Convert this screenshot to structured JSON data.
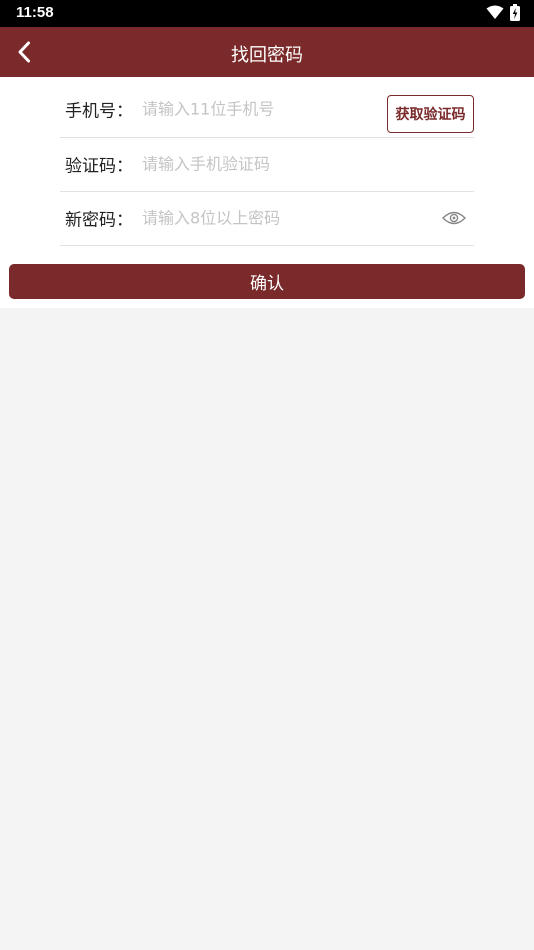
{
  "status_bar": {
    "time": "11:58"
  },
  "app_bar": {
    "title": "找回密码"
  },
  "form": {
    "phone": {
      "label": "手机号：",
      "placeholder": "请输入11位手机号",
      "value": ""
    },
    "get_code_label": "获取验证码",
    "code": {
      "label": "验证码：",
      "placeholder": "请输入手机验证码",
      "value": ""
    },
    "password": {
      "label": "新密码：",
      "placeholder": "请输入8位以上密码",
      "value": ""
    },
    "confirm_label": "确认"
  },
  "colors": {
    "brand": "#7a2a2a",
    "background": "#f4f4f4",
    "placeholder": "#c4c4c4"
  },
  "icons": [
    "wifi-icon",
    "battery-icon",
    "back-icon",
    "eye-icon"
  ]
}
